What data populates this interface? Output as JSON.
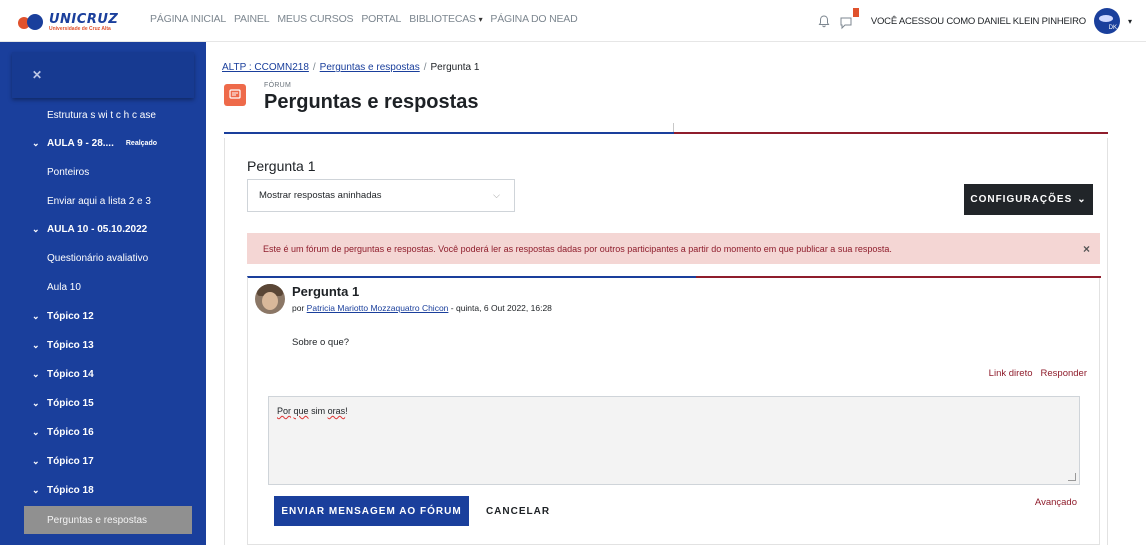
{
  "brand": {
    "name": "UNICRUZ",
    "subtitle": "Universidade de Cruz Alta"
  },
  "topnav": {
    "items": [
      "PÁGINA INICIAL",
      "PAINEL",
      "MEUS CURSOS",
      "PORTAL",
      "BIBLIOTECAS",
      "PÁGINA DO NEAD"
    ],
    "user_label": "VOCÊ ACESSOU COMO DANIEL KLEIN PINHEIRO",
    "avatar_initials": "DK"
  },
  "sidebar": {
    "items": [
      {
        "label": "Estrutura s wi t c h c ase",
        "type": "leaf"
      },
      {
        "label": "AULA 9 - 28....",
        "type": "section",
        "tag": "Realçado"
      },
      {
        "label": "Ponteiros",
        "type": "leaf"
      },
      {
        "label": "Enviar aqui a lista 2 e 3",
        "type": "leaf"
      },
      {
        "label": "AULA 10 - 05.10.2022",
        "type": "section"
      },
      {
        "label": "Questionário avaliativo",
        "type": "leaf"
      },
      {
        "label": "Aula 10",
        "type": "leaf"
      },
      {
        "label": "Tópico 12",
        "type": "section"
      },
      {
        "label": "Tópico 13",
        "type": "section"
      },
      {
        "label": "Tópico 14",
        "type": "section"
      },
      {
        "label": "Tópico 15",
        "type": "section"
      },
      {
        "label": "Tópico 16",
        "type": "section"
      },
      {
        "label": "Tópico 17",
        "type": "section"
      },
      {
        "label": "Tópico 18",
        "type": "section"
      },
      {
        "label": "Perguntas e respostas",
        "type": "active"
      }
    ]
  },
  "breadcrumb": {
    "course": "ALTP : CCOMN218",
    "forum": "Perguntas e respostas",
    "current": "Pergunta 1"
  },
  "page": {
    "kind": "FÓRUM",
    "title": "Perguntas e respostas"
  },
  "discussion": {
    "title": "Pergunta 1",
    "display_mode": "Mostrar respostas aninhadas",
    "settings_label": "CONFIGURAÇÕES",
    "alert": "Este é um fórum de perguntas e respostas. Você poderá ler as respostas dadas por outros participantes a partir do momento em que publicar a sua resposta."
  },
  "post": {
    "subject": "Pergunta 1",
    "by": "por",
    "author": "Patricia Mariotto Mozzaquatro Chicon",
    "date": "quinta, 6 Out 2022, 16:28",
    "body": "Sobre o que?",
    "permalink_label": "Link direto",
    "reply_label": "Responder"
  },
  "reply": {
    "word1": "Por",
    "word2": "que",
    "word3": "sim",
    "word4": "oras",
    "punct": "!",
    "send_label": "ENVIAR MENSAGEM AO FÓRUM",
    "cancel_label": "CANCELAR",
    "advanced_label": "Avançado"
  },
  "colors": {
    "primary": "#1a3f9c",
    "accent": "#8f1d2c",
    "forum_icon": "#ee6a4a"
  }
}
